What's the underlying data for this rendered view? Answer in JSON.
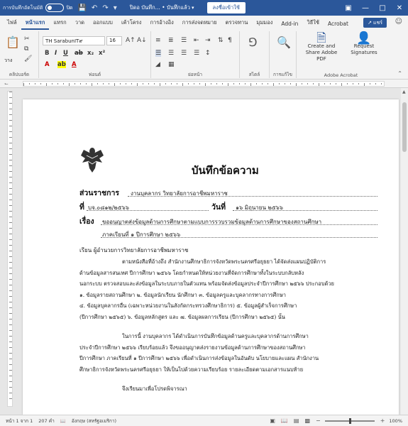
{
  "titlebar": {
    "autosave_label": "การบันทึกอัตโนมัติ",
    "autosave_state": "ปิด",
    "doc_title": "ปิดอ บันทึก... • บันทึกแล้ว",
    "signin_label": "ลงชื่อเข้าใช้",
    "icons": [
      "save-icon",
      "undo-icon",
      "redo-icon",
      "customize-qat-icon"
    ]
  },
  "tabs": [
    "ไฟล์",
    "หน้าแรก",
    "แทรก",
    "วาด",
    "ออกแบบ",
    "เค้าโครง",
    "การอ้างอิง",
    "การส่งจดหมาย",
    "ตรวจทาน",
    "มุมมอง",
    "Add-in",
    "วิธีใช้",
    "Acrobat"
  ],
  "active_tab": "หน้าแรก",
  "share_label": "แชร์",
  "ribbon": {
    "clipboard_label": "คลิปบอร์ด",
    "paste_label": "วาง",
    "font_name": "TH SarabunIT๙",
    "font_size": "16",
    "font_label": "ฟอนต์",
    "paragraph_label": "ย่อหน้า",
    "styles_label": "สไตล์",
    "editing_label": "การแก้ไข",
    "create_share_pdf_label": "Create and Share Adobe PDF",
    "request_signatures_label": "Request Signatures",
    "adobe_group_label": "Adobe Acrobat"
  },
  "document": {
    "title": "บันทึกข้อความ",
    "department_label": "ส่วนราชการ",
    "department_value": "งานบุคลากร   วิทยาลัยการอาชีพมหาราช",
    "ref_label": "ที่",
    "ref_value": "บจ.๐๘๑๒/๒๕๖๖",
    "date_label": "วันที่",
    "date_value": "๑๖ มิถุนายน ๒๕๖๖",
    "subject_label": "เรื่อง",
    "subject_line1": "ขออนุญาตส่งข้อมูลด้านการศึกษาตามแบบการรวบรวมข้อมูลด้านการศึกษาของสถานศึกษา",
    "subject_line2": "ภาคเรียนที่ ๑ ปีการศึกษา ๒๕๖๖",
    "recipient": "เรียน   ผู้อำนวยการวิทยาลัยการอาชีพมหาราช",
    "para1_lines": [
      "ตามหนังสือที่อ้างถึง สำนักงานศึกษาธิการจังหวัดพระนครศรีอยุธยา ได้จัดส่งแผนปฏิบัติการ",
      "ด้านข้อมูลสารสนเทศ ปีการศึกษา ๒๕๖๖ โดยกำหนดให้หน่วยงานที่จัดการศึกษาทั้งในระบบกลับหลัง",
      "นอกระบบ ตรวจสอบและส่งข้อมูลในระบบภายในตัวแทน พร้อมจัดส่งข้อมูลประจำปีการศึกษา ๒๕๖๖ ประกอบด้วย",
      "๑. ข้อมูลรายสถานศึกษา ๒. ข้อมูลนักเรียน นักศึกษา ๓. ข้อมูลครูและบุคลากรทางการศึกษา",
      "๔. ข้อมูลบุคลากรอื่น (เฉพาะหน่วยงานในสังกัดกระทรวงศึกษาธิการ) ๕. ข้อมูลผู้สำเร็จการศึกษา",
      "(ปีการศึกษา ๒๕๖๕) ๖. ข้อมูลหลักสูตร และ ๗. ข้อมูลผลการเรียน (ปีการศึกษา ๒๕๖๕) นั้น"
    ],
    "para2_lines": [
      "ในการนี้ งานบุคลากร ได้ดำเนินการบันทึกข้อมูลด้านครูและบุคลากรด้านการศึกษา",
      "ประจำปีการศึกษา ๒๕๖๖ เรียบร้อยแล้ว จึงขออนุญาตส่งรายงานข้อมูลด้านการศึกษาของสถานศึกษา",
      "ปีการศึกษา ภาคเรียนที่ ๑ ปีการศึกษา ๒๕๖๖ เพื่อดำเนินการส่งข้อมูลในอันดับ นโยบายและแผน สำนักงาน",
      "ศึกษาธิการจังหวัดพระนครศรีอยุธยา ให้เป็นไปด้วยความเรียบร้อย รายละเอียดตามเอกสารแนบท้าย"
    ],
    "closing": "จึงเรียนมาเพื่อโปรดพิจารณา"
  },
  "statusbar": {
    "page": "หน้า 1 จาก 1",
    "words": "207 คำ",
    "language": "อังกฤษ (สหรัฐอเมริกา)",
    "zoom": "100%"
  }
}
